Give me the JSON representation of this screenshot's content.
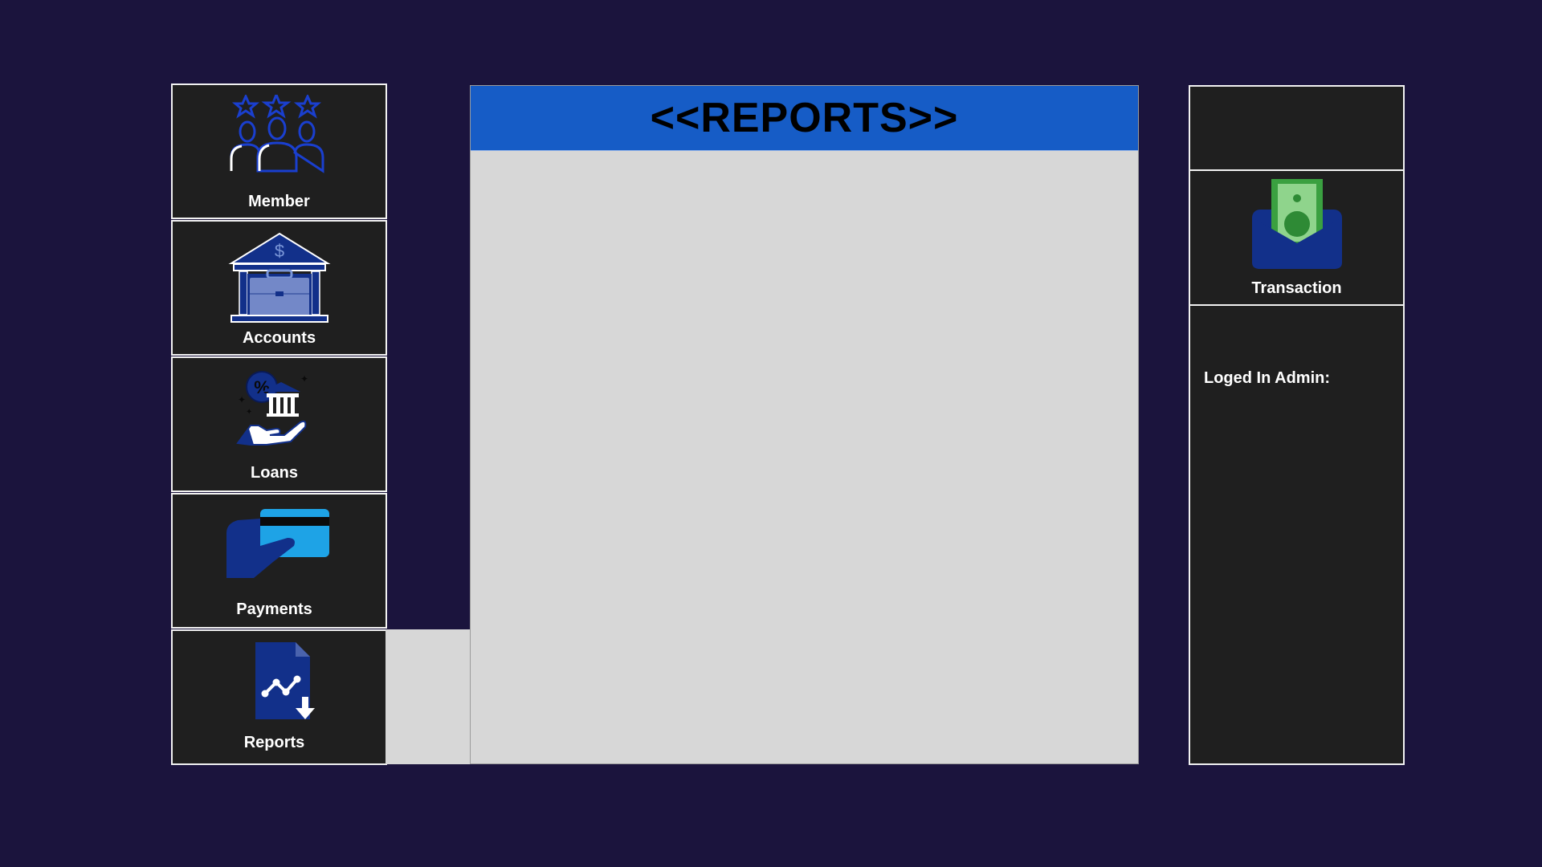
{
  "sidebar": {
    "items": [
      {
        "label": "Member",
        "icon": "member-group-icon"
      },
      {
        "label": "Accounts",
        "icon": "bank-briefcase-icon"
      },
      {
        "label": "Loans",
        "icon": "loan-hand-icon"
      },
      {
        "label": "Payments",
        "icon": "card-payment-icon"
      },
      {
        "label": "Reports",
        "icon": "report-download-icon"
      }
    ]
  },
  "main": {
    "title": "<<REPORTS>>"
  },
  "right_panel": {
    "transaction_label": "Transaction",
    "transaction_icon": "money-envelope-icon",
    "admin_label": "Loged In Admin:"
  },
  "colors": {
    "background": "#1b143d",
    "tile": "#1f1f1f",
    "header_blue": "#165cc6",
    "content_gray": "#d7d7d7",
    "icon_blue": "#12308a"
  }
}
